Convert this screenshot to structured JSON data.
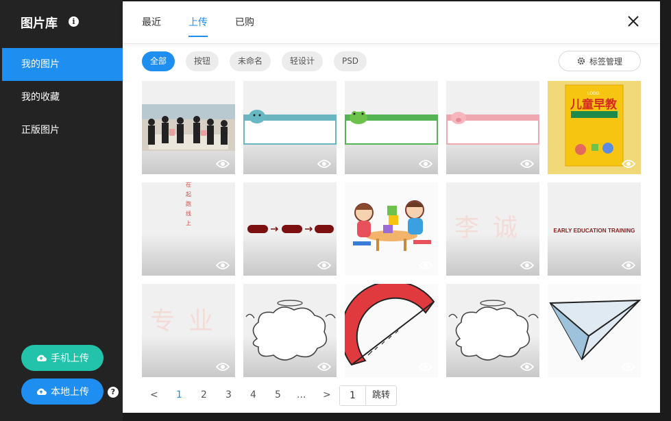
{
  "sidebar": {
    "title": "图片库",
    "items": [
      {
        "label": "我的图片"
      },
      {
        "label": "我的收藏"
      },
      {
        "label": "正版图片"
      }
    ],
    "mobile_upload": "手机上传",
    "local_upload": "本地上传"
  },
  "tabs": [
    {
      "label": "最近"
    },
    {
      "label": "上传"
    },
    {
      "label": "已购"
    }
  ],
  "filters": [
    {
      "label": "全部"
    },
    {
      "label": "按钮"
    },
    {
      "label": "未命名"
    },
    {
      "label": "轻设计"
    },
    {
      "label": "PSD"
    }
  ],
  "tag_manage": "标签管理",
  "thumbs": {
    "t5": "儿童早教",
    "t5b": "LOGO",
    "t7": "让孩子赢在起跑线上",
    "t9": "李诚",
    "t10": "EARLY EDUCATION TRAINING",
    "t11": "专业"
  },
  "pager": {
    "prev": "<",
    "pages": [
      "1",
      "2",
      "3",
      "4",
      "5",
      "..."
    ],
    "next": ">",
    "jump_value": "1",
    "jump_label": "跳转"
  },
  "colors": {
    "accent": "#1f8ef1",
    "mobile_upload": "#22c3aa",
    "sidebar_bg": "#232323"
  }
}
